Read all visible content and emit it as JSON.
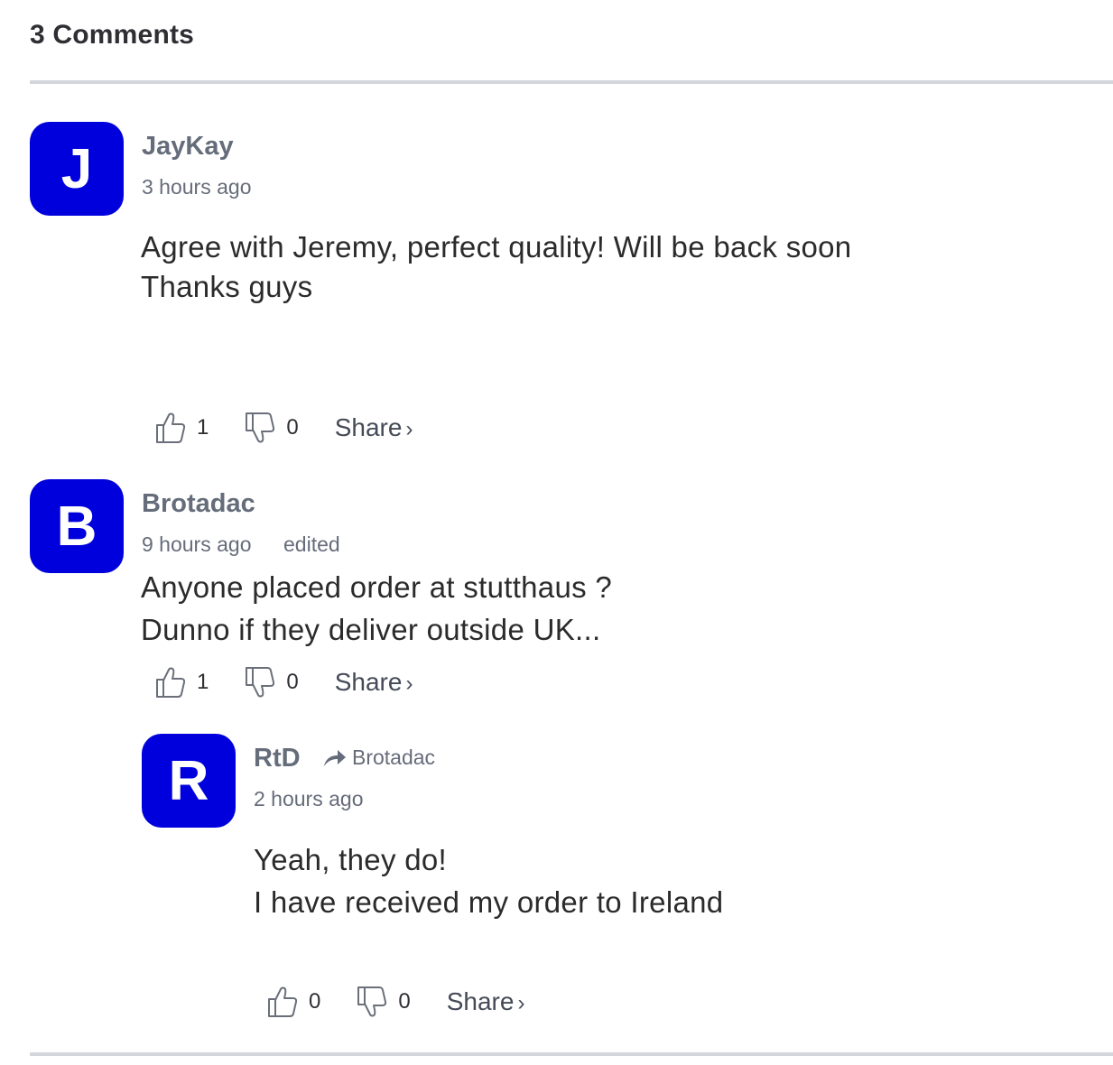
{
  "header": {
    "title": "3 Comments"
  },
  "comments": [
    {
      "avatar_letter": "J",
      "author": "JayKay",
      "time": "3 hours ago",
      "body": "Agree with Jeremy, perfect quality! Will be back soon\nThanks guys",
      "upvotes": "1",
      "downvotes": "0",
      "share_label": "Share",
      "share_chevron": "›"
    },
    {
      "avatar_letter": "B",
      "author": "Brotadac",
      "time": "9 hours ago",
      "edited": "edited",
      "body": "Anyone placed order at stutthaus ?\nDunno if they deliver outside UK...",
      "upvotes": "1",
      "downvotes": "0",
      "share_label": "Share",
      "share_chevron": "›"
    },
    {
      "avatar_letter": "R",
      "author": "RtD",
      "reply_to": "Brotadac",
      "time": "2 hours ago",
      "body": "Yeah, they do!\nI have received my order to Ireland",
      "upvotes": "0",
      "downvotes": "0",
      "share_label": "Share",
      "share_chevron": "›"
    }
  ],
  "colors": {
    "avatar_bg": "#0000dd",
    "meta_text": "#656c7a",
    "divider": "#d5d6dc"
  }
}
